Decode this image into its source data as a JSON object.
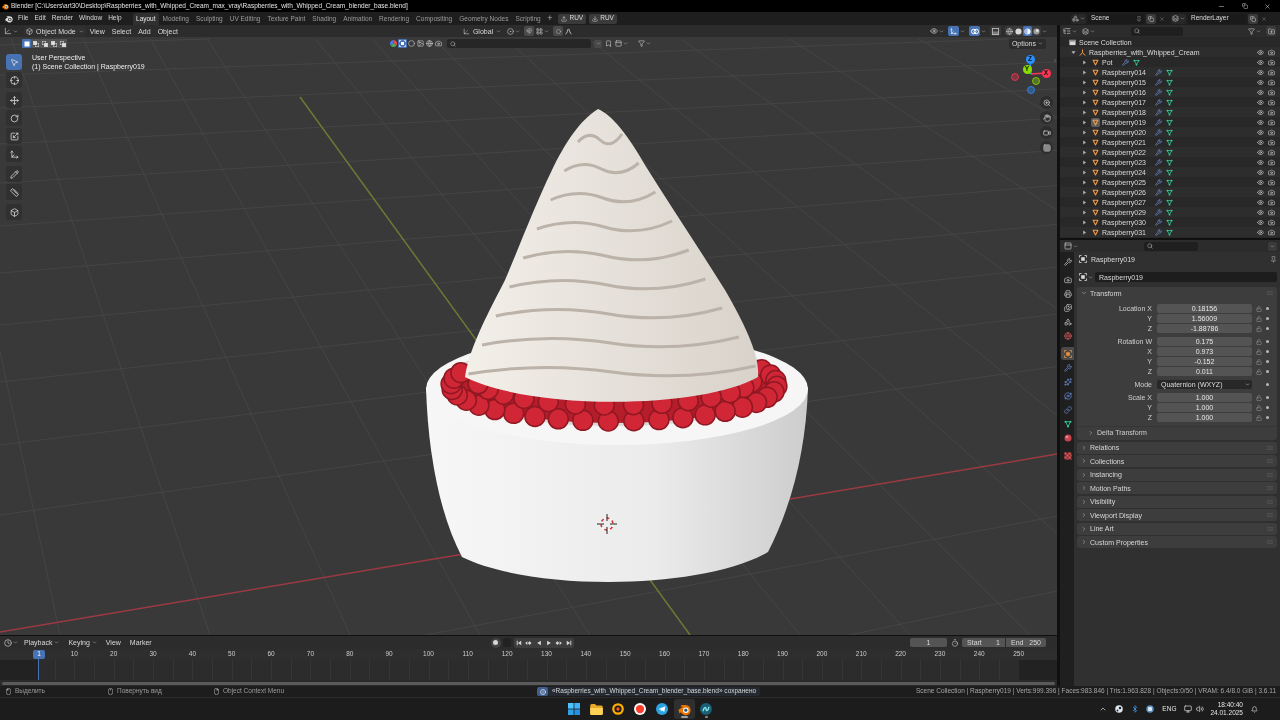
{
  "title_bar": {
    "title": "Blender [C:\\Users\\art30\\Desktop\\Raspberries_with_Whipped_Cream_max_vray\\Raspberries_with_Whipped_Cream_blender_base.blend]"
  },
  "top_bar": {
    "menus": [
      "File",
      "Edit",
      "Render",
      "Window",
      "Help"
    ],
    "workspaces": [
      {
        "label": "Layout",
        "selected": true
      },
      {
        "label": "Modeling",
        "selected": false
      },
      {
        "label": "Sculpting",
        "selected": false
      },
      {
        "label": "UV Editing",
        "selected": false
      },
      {
        "label": "Texture Paint",
        "selected": false
      },
      {
        "label": "Shading",
        "selected": false
      },
      {
        "label": "Animation",
        "selected": false
      },
      {
        "label": "Rendering",
        "selected": false
      },
      {
        "label": "Compositing",
        "selected": false
      },
      {
        "label": "Geometry Nodes",
        "selected": false
      },
      {
        "label": "Scripting",
        "selected": false
      }
    ],
    "add_workspace": "+",
    "addon_buttons": [
      {
        "kind": "upload",
        "label": "RUV"
      },
      {
        "kind": "download",
        "label": "RUV"
      }
    ],
    "scene": "Scene",
    "view_layer": "RenderLayer"
  },
  "viewport": {
    "mode": "Object Mode",
    "menus": [
      "View",
      "Select",
      "Add",
      "Object"
    ],
    "orientation": "Global",
    "toggles": [
      {
        "kind": "gizmo",
        "on": true
      },
      {
        "kind": "overlay",
        "on": true
      },
      {
        "kind": "xray",
        "on": false
      }
    ],
    "shading_modes": [
      {
        "kind": "wireframe",
        "selected": false
      },
      {
        "kind": "solid",
        "selected": false
      },
      {
        "kind": "material",
        "selected": true
      },
      {
        "kind": "rendered",
        "selected": false
      }
    ],
    "selection_modes": [
      {
        "kind": "set",
        "selected": true
      },
      {
        "kind": "extend",
        "selected": false
      },
      {
        "kind": "subtract",
        "selected": false
      },
      {
        "kind": "invert",
        "selected": false
      },
      {
        "kind": "intersect",
        "selected": false
      }
    ],
    "filter_icons": [
      {
        "kind": "color",
        "selected": false
      },
      {
        "kind": "object",
        "selected": true
      },
      {
        "kind": "sphere",
        "selected": false
      },
      {
        "kind": "image",
        "selected": false
      },
      {
        "kind": "world",
        "selected": false
      },
      {
        "kind": "camera",
        "selected": false
      }
    ],
    "options": "Options",
    "info_lines": [
      "User Perspective",
      "(1) Scene Collection | Raspberry019"
    ],
    "tools": [
      {
        "kind": "select",
        "selected": true
      },
      {
        "kind": "cursor",
        "selected": false
      },
      {
        "kind": "move",
        "selected": false
      },
      {
        "kind": "rotate",
        "selected": false
      },
      {
        "kind": "scale",
        "selected": false
      },
      {
        "kind": "transform",
        "selected": false
      },
      {
        "kind": "annotate",
        "selected": false
      },
      {
        "kind": "measure",
        "selected": false
      },
      {
        "kind": "add_cube",
        "selected": false
      }
    ],
    "gizmo_axes": [
      {
        "label": "X",
        "color": "#ff3352"
      },
      {
        "label": "Y",
        "color": "#8bdc00"
      },
      {
        "label": "Z",
        "color": "#2890ff"
      }
    ],
    "nav_buttons": [
      {
        "kind": "zoom"
      },
      {
        "kind": "pan"
      },
      {
        "kind": "camera"
      },
      {
        "kind": "ortho"
      }
    ]
  },
  "outliner": {
    "root": "Scene Collection",
    "tree": [
      {
        "label": "Raspberries_with_Whipped_Cream",
        "expanded": true,
        "children": [
          {
            "label": "Pot",
            "expanded": false,
            "selected": false
          },
          {
            "label": "Raspberry014",
            "expanded": false,
            "selected": false
          },
          {
            "label": "Raspberry015",
            "expanded": false,
            "selected": false
          },
          {
            "label": "Raspberry016",
            "expanded": false,
            "selected": false
          },
          {
            "label": "Raspberry017",
            "expanded": false,
            "selected": false
          },
          {
            "label": "Raspberry018",
            "expanded": false,
            "selected": false
          },
          {
            "label": "Raspberry019",
            "expanded": false,
            "selected": true
          },
          {
            "label": "Raspberry020",
            "expanded": false,
            "selected": false
          },
          {
            "label": "Raspberry021",
            "expanded": false,
            "selected": false
          },
          {
            "label": "Raspberry022",
            "expanded": false,
            "selected": false
          },
          {
            "label": "Raspberry023",
            "expanded": false,
            "selected": false
          },
          {
            "label": "Raspberry024",
            "expanded": false,
            "selected": false
          },
          {
            "label": "Raspberry025",
            "expanded": false,
            "selected": false
          },
          {
            "label": "Raspberry026",
            "expanded": false,
            "selected": false
          },
          {
            "label": "Raspberry027",
            "expanded": false,
            "selected": false
          },
          {
            "label": "Raspberry029",
            "expanded": false,
            "selected": false
          },
          {
            "label": "Raspberry030",
            "expanded": false,
            "selected": false
          },
          {
            "label": "Raspberry031",
            "expanded": false,
            "selected": false
          }
        ]
      }
    ]
  },
  "properties": {
    "tabs": [
      {
        "kind": "tool",
        "selected": false
      },
      {
        "kind": "render",
        "selected": false
      },
      {
        "kind": "output",
        "selected": false
      },
      {
        "kind": "view_layer",
        "selected": false
      },
      {
        "kind": "scene",
        "selected": false
      },
      {
        "kind": "world",
        "selected": false
      },
      {
        "kind": "object",
        "selected": true
      },
      {
        "kind": "modifiers",
        "selected": false
      },
      {
        "kind": "particles",
        "selected": false
      },
      {
        "kind": "physics",
        "selected": false
      },
      {
        "kind": "constraints",
        "selected": false
      },
      {
        "kind": "data",
        "selected": false
      },
      {
        "kind": "material",
        "selected": false
      },
      {
        "kind": "texture",
        "selected": false
      }
    ],
    "object_name": "Raspberry019",
    "data_name": "Raspberry019",
    "panels": [
      {
        "label": "Transform",
        "expanded": true,
        "groups": [
          [
            {
              "kind": "number",
              "label": "Location X",
              "value": "0.18156"
            },
            {
              "kind": "number",
              "label": "Y",
              "value": "1.56009"
            },
            {
              "kind": "number",
              "label": "Z",
              "value": "-1.88786"
            }
          ],
          [
            {
              "kind": "number",
              "label": "Rotation W",
              "value": "0.175"
            },
            {
              "kind": "number",
              "label": "X",
              "value": "0.973"
            },
            {
              "kind": "number",
              "label": "Y",
              "value": "-0.152"
            },
            {
              "kind": "number",
              "label": "Z",
              "value": "0.011"
            }
          ],
          [
            {
              "kind": "dropdown",
              "label": "Mode",
              "value": "Quaternion (WXYZ)"
            }
          ],
          [
            {
              "kind": "number",
              "label": "Scale X",
              "value": "1.000"
            },
            {
              "kind": "number",
              "label": "Y",
              "value": "1.000"
            },
            {
              "kind": "number",
              "label": "Z",
              "value": "1.000"
            }
          ]
        ],
        "subpanels": [
          {
            "label": "Delta Transform",
            "expanded": false
          }
        ]
      },
      {
        "label": "Relations",
        "expanded": false
      },
      {
        "label": "Collections",
        "expanded": false
      },
      {
        "label": "Instancing",
        "expanded": false
      },
      {
        "label": "Motion Paths",
        "expanded": false
      },
      {
        "label": "Visibility",
        "expanded": false
      },
      {
        "label": "Viewport Display",
        "expanded": false
      },
      {
        "label": "Line Art",
        "expanded": false
      },
      {
        "label": "Custom Properties",
        "expanded": false
      }
    ]
  },
  "timeline": {
    "menus": [
      {
        "label": "Playback",
        "kind": "popover"
      },
      {
        "label": "Keying",
        "kind": "popover"
      },
      {
        "label": "View",
        "kind": "menu"
      },
      {
        "label": "Marker",
        "kind": "menu"
      }
    ],
    "controls": [
      {
        "kind": "jump_start"
      },
      {
        "kind": "prev_key"
      },
      {
        "kind": "play_reverse"
      },
      {
        "kind": "play"
      },
      {
        "kind": "next_key"
      },
      {
        "kind": "jump_end"
      }
    ],
    "current_frame": "1",
    "start_label": "Start",
    "start": "1",
    "end_label": "End",
    "end": "250",
    "playhead": "1",
    "ticks": [
      "10",
      "20",
      "30",
      "40",
      "50",
      "60",
      "70",
      "80",
      "90",
      "100",
      "110",
      "120",
      "130",
      "140",
      "150",
      "160",
      "170",
      "180",
      "190",
      "200",
      "210",
      "220",
      "230",
      "240",
      "250"
    ]
  },
  "status_bar": {
    "hints": [
      {
        "kind": "left",
        "label": "Выделить"
      },
      {
        "kind": "middle",
        "label": "Повернуть вид"
      },
      {
        "kind": "right",
        "label": "Object Context Menu"
      }
    ],
    "message": "«Raspberries_with_Whipped_Cream_blender_base.blend» сохранено",
    "stats": "Scene Collection | Raspberry019 | Verts:999.396 | Faces:983.846 | Tris:1.963.828 | Objects:0/50 | VRAM: 6.4/8.0 GiB | 3.6.11"
  },
  "taskbar": {
    "apps": [
      {
        "kind": "start",
        "selected": false,
        "running": false
      },
      {
        "kind": "files",
        "selected": false,
        "running": false
      },
      {
        "kind": "ring",
        "selected": false,
        "running": false
      },
      {
        "kind": "browser",
        "selected": false,
        "running": false
      },
      {
        "kind": "messenger",
        "selected": false,
        "running": false
      },
      {
        "kind": "blender",
        "selected": true,
        "running": true
      },
      {
        "kind": "swirl",
        "selected": false,
        "running": true
      }
    ],
    "language": "ENG",
    "time": "18:40:40",
    "date": "24.01.2025"
  }
}
